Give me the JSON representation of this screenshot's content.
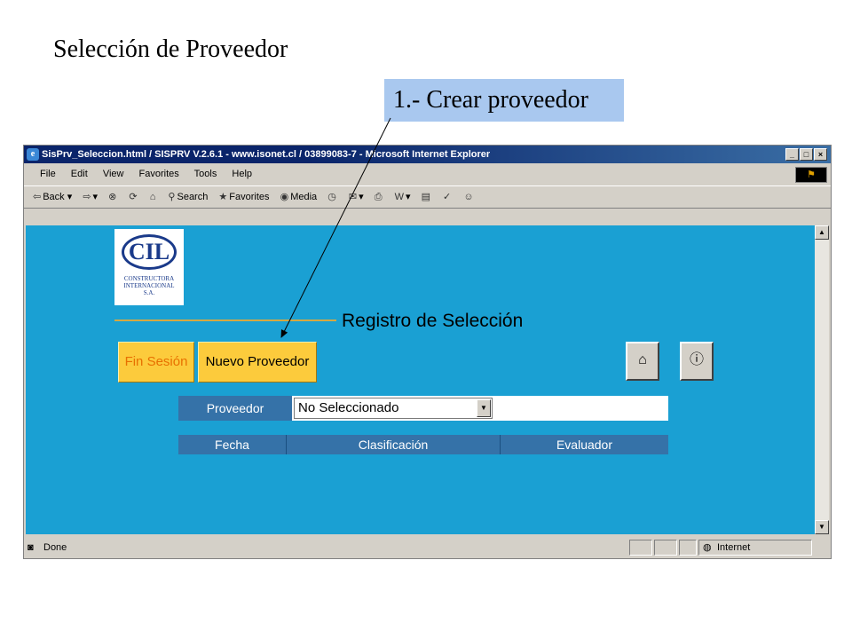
{
  "slide": {
    "title": "Selección de Proveedor",
    "callout": "1.- Crear proveedor"
  },
  "browser": {
    "window_title": "SisPrv_Seleccion.html / SISPRV V.2.6.1 - www.isonet.cl / 03899083-7 - Microsoft Internet Explorer",
    "window_buttons": [
      "_",
      "□",
      "×"
    ],
    "menu": [
      "File",
      "Edit",
      "View",
      "Favorites",
      "Tools",
      "Help"
    ],
    "toolbar": {
      "back": "Back",
      "search": "Search",
      "favorites": "Favorites",
      "media": "Media"
    },
    "status": {
      "left": "Done",
      "zone": "Internet"
    }
  },
  "page": {
    "logo": {
      "initials": "CIL",
      "line1": "CONSTRUCTORA",
      "line2": "INTERNACIONAL",
      "line3": "S.A."
    },
    "heading": "Registro de Selección",
    "buttons": {
      "fin_sesion": "Fin Sesión",
      "nuevo_proveedor": "Nuevo Proveedor"
    },
    "proveedor": {
      "label": "Proveedor",
      "selected": "No Seleccionado"
    },
    "table_headers": [
      "Fecha",
      "Clasificación",
      "Evaluador"
    ]
  },
  "colors": {
    "content_bg": "#1aa0d3",
    "header_cell": "#3572a8",
    "button_yellow": "#fccb3c",
    "callout_bg": "#a9c8ef",
    "gold_line": "#d4a843"
  }
}
